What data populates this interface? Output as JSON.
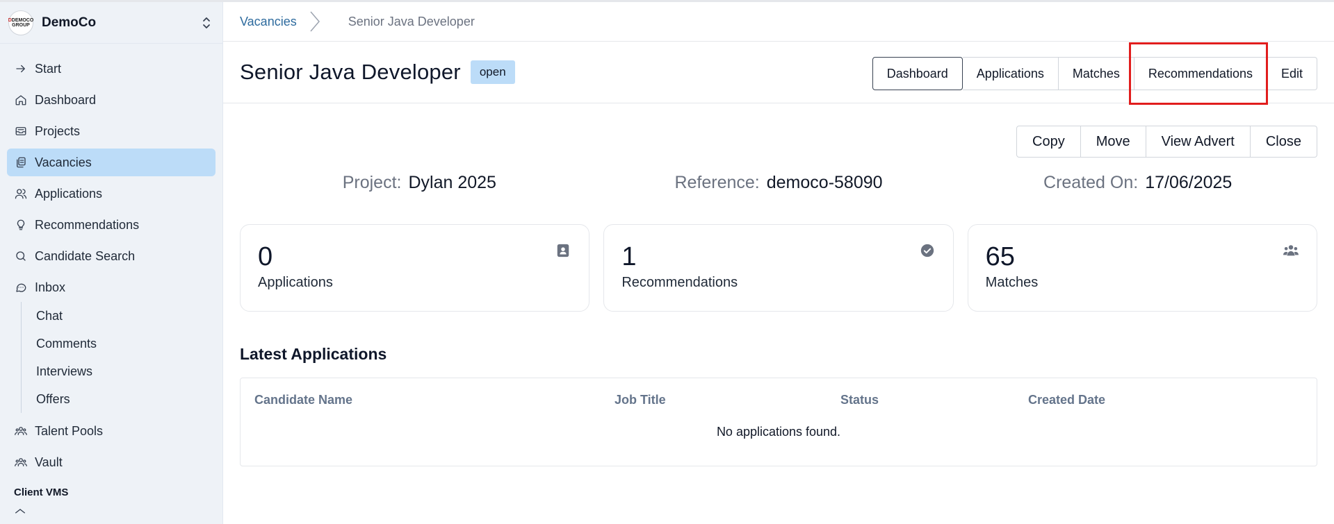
{
  "org": {
    "name": "DemoCo",
    "logo_top": "DEMOCO",
    "logo_bottom": "GROUP"
  },
  "sidebar": {
    "items": [
      {
        "label": "Start",
        "icon": "arrow-right-icon"
      },
      {
        "label": "Dashboard",
        "icon": "home-icon"
      },
      {
        "label": "Projects",
        "icon": "inbox-tray-icon"
      },
      {
        "label": "Vacancies",
        "icon": "clipboard-icon",
        "active": true
      },
      {
        "label": "Applications",
        "icon": "users-icon"
      },
      {
        "label": "Recommendations",
        "icon": "lightbulb-icon"
      },
      {
        "label": "Candidate Search",
        "icon": "search-icon"
      },
      {
        "label": "Inbox",
        "icon": "message-icon"
      }
    ],
    "inbox_sub": [
      "Chat",
      "Comments",
      "Interviews",
      "Offers"
    ],
    "items_after": [
      {
        "label": "Talent Pools",
        "icon": "users-group-icon"
      },
      {
        "label": "Vault",
        "icon": "users-group-icon"
      }
    ],
    "section_label": "Client VMS"
  },
  "breadcrumb": {
    "parent": "Vacancies",
    "current": "Senior Java Developer"
  },
  "header": {
    "title": "Senior Java Developer",
    "status": "open",
    "tabs": [
      "Dashboard",
      "Applications",
      "Matches",
      "Recommendations",
      "Edit"
    ]
  },
  "actions": [
    "Copy",
    "Move",
    "View Advert",
    "Close"
  ],
  "meta": {
    "project_label": "Project:",
    "project_value": "Dylan 2025",
    "reference_label": "Reference:",
    "reference_value": "democo-58090",
    "created_label": "Created On:",
    "created_value": "17/06/2025"
  },
  "stats": [
    {
      "value": "0",
      "label": "Applications",
      "icon": "contact-card-icon"
    },
    {
      "value": "1",
      "label": "Recommendations",
      "icon": "check-badge-icon"
    },
    {
      "value": "65",
      "label": "Matches",
      "icon": "users-fill-icon"
    }
  ],
  "latest": {
    "title": "Latest Applications",
    "columns": [
      "Candidate Name",
      "Job Title",
      "Status",
      "Created Date"
    ],
    "empty": "No applications found."
  },
  "colors": {
    "accent": "#bcdcf8",
    "link": "#2e6b9e",
    "highlight": "#e11d1d"
  }
}
